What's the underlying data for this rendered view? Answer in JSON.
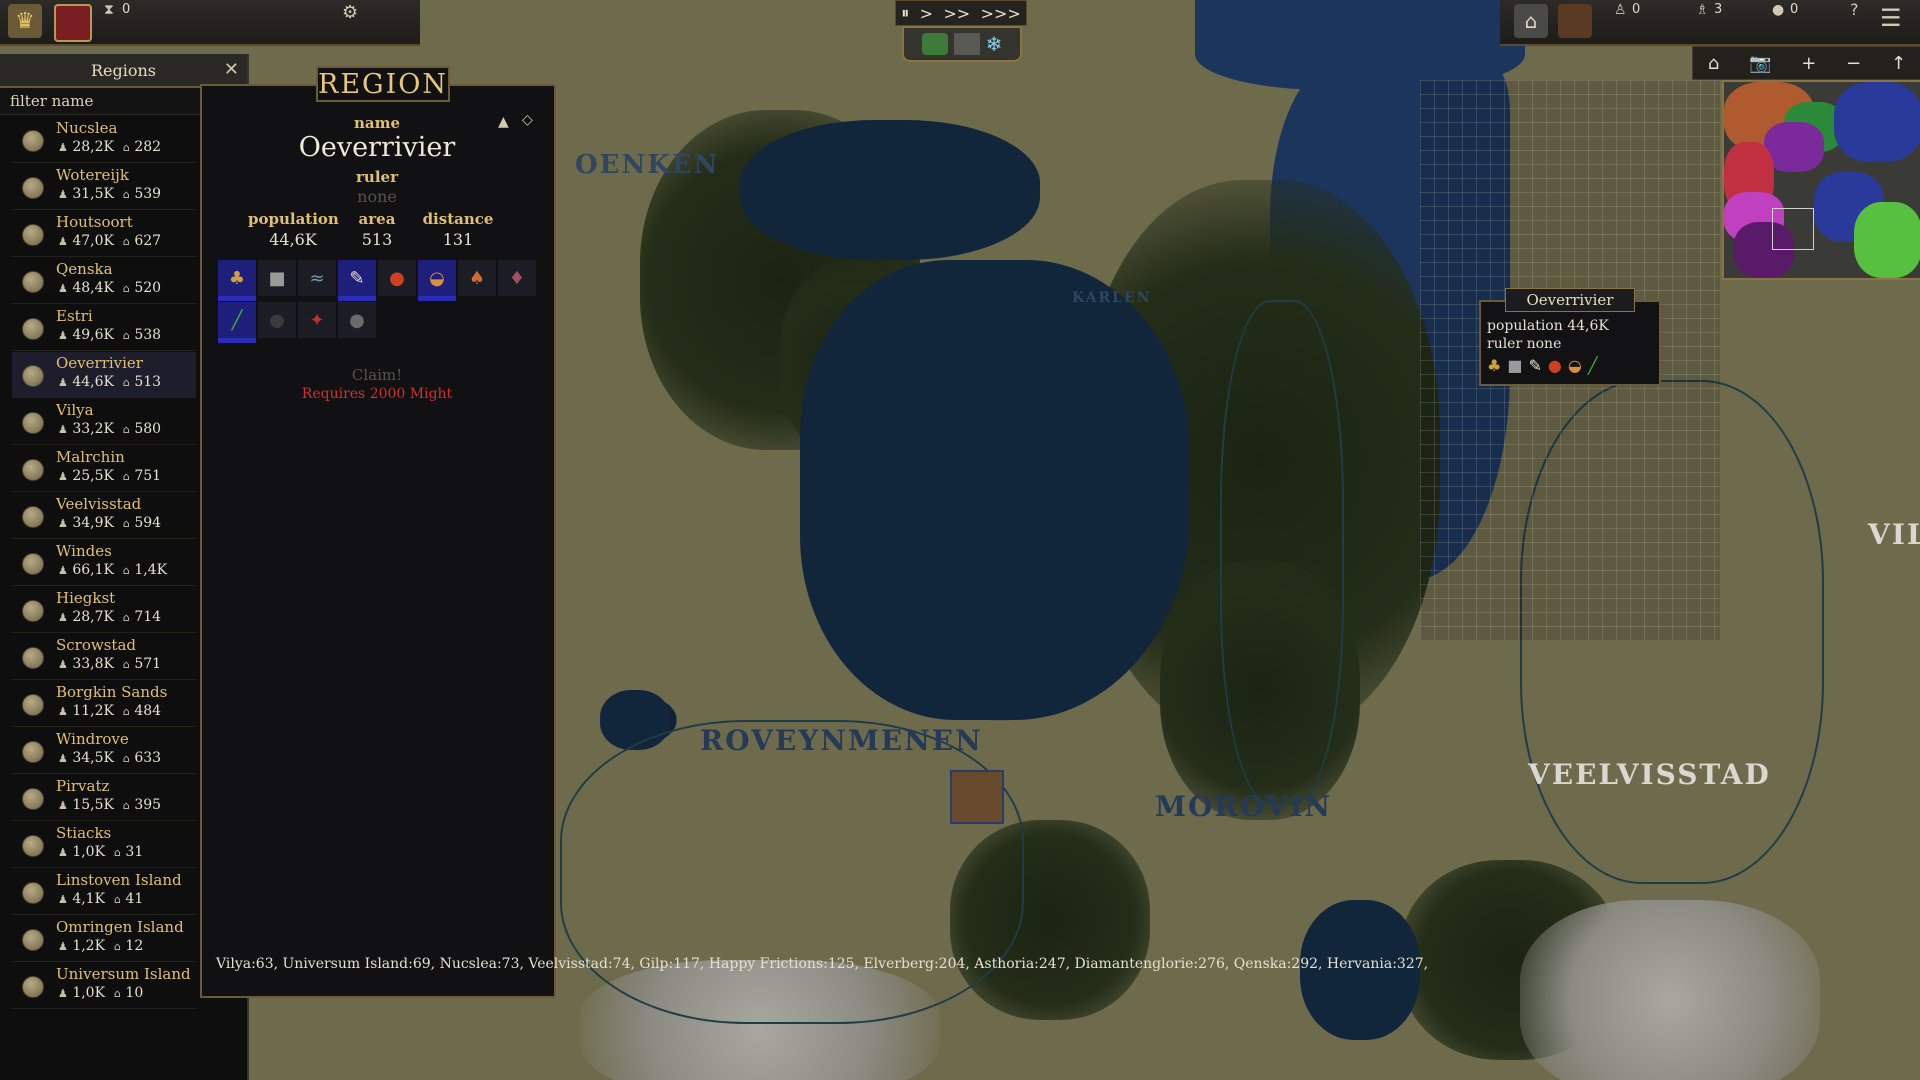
{
  "topbar": {
    "left_counter": "0",
    "right_counters": [
      "0",
      "3",
      "0"
    ],
    "speed_buttons": [
      "⏸",
      ">",
      ">>",
      ">>>"
    ],
    "question_icon": "?"
  },
  "minimap_tools": [
    "⌂",
    "📷",
    "+",
    "−",
    "↑"
  ],
  "regions_panel": {
    "title": "Regions",
    "close": "✕",
    "filter_placeholder": "filter name",
    "rows": [
      {
        "name": "Nucslea",
        "pop": "28,2K",
        "area": "282"
      },
      {
        "name": "Wotereijk",
        "pop": "31,5K",
        "area": "539"
      },
      {
        "name": "Houtsoort",
        "pop": "47,0K",
        "area": "627"
      },
      {
        "name": "Qenska",
        "pop": "48,4K",
        "area": "520"
      },
      {
        "name": "Estri",
        "pop": "49,6K",
        "area": "538"
      },
      {
        "name": "Oeverrivier",
        "pop": "44,6K",
        "area": "513"
      },
      {
        "name": "Vilya",
        "pop": "33,2K",
        "area": "580"
      },
      {
        "name": "Malrchin",
        "pop": "25,5K",
        "area": "751"
      },
      {
        "name": "Veelvisstad",
        "pop": "34,9K",
        "area": "594"
      },
      {
        "name": "Windes",
        "pop": "66,1K",
        "area": "1,4K"
      },
      {
        "name": "Hiegkst",
        "pop": "28,7K",
        "area": "714"
      },
      {
        "name": "Scrowstad",
        "pop": "33,8K",
        "area": "571"
      },
      {
        "name": "Borgkin Sands",
        "pop": "11,2K",
        "area": "484"
      },
      {
        "name": "Windrove",
        "pop": "34,5K",
        "area": "633"
      },
      {
        "name": "Pirvatz",
        "pop": "15,5K",
        "area": "395"
      },
      {
        "name": "Stiacks",
        "pop": "1,0K",
        "area": "31"
      },
      {
        "name": "Linstoven Island",
        "pop": "4,1K",
        "area": "41"
      },
      {
        "name": "Omringen Island",
        "pop": "1,2K",
        "area": "12"
      },
      {
        "name": "Universum Island",
        "pop": "1,0K",
        "area": "10"
      }
    ]
  },
  "region": {
    "header": "REGION",
    "name_label": "name",
    "name": "Oeverrivier",
    "ruler_label": "ruler",
    "ruler": "none",
    "population_label": "population",
    "population": "44,6K",
    "area_label": "area",
    "area": "513",
    "distance_label": "distance",
    "distance": "131",
    "claim": "Claim!",
    "requirement": "Requires 2000 Might",
    "neighbors": "Vilya:63, Universum Island:69, Nucslea:73, Veelvisstad:74, Gilp:117, Happy Frictions:125, Elverberg:204, Asthoria:247, Diamantenglorie:276, Qenska:292, Hervania:327,"
  },
  "map_labels": [
    "OENKEN",
    "ROVEYNMENEN",
    "MOROVIN",
    "VEELVISSTAD",
    "VIL",
    "KARLEN"
  ],
  "tooltip": {
    "title": "Oeverrivier",
    "population_line": "population 44,6K",
    "ruler_line": "ruler none"
  },
  "colors": {
    "panel_bg": "#111114",
    "gold": "#e0c070",
    "red_text": "#d03030",
    "map_land": "#6e6a4c",
    "sea": "#1c355c"
  }
}
